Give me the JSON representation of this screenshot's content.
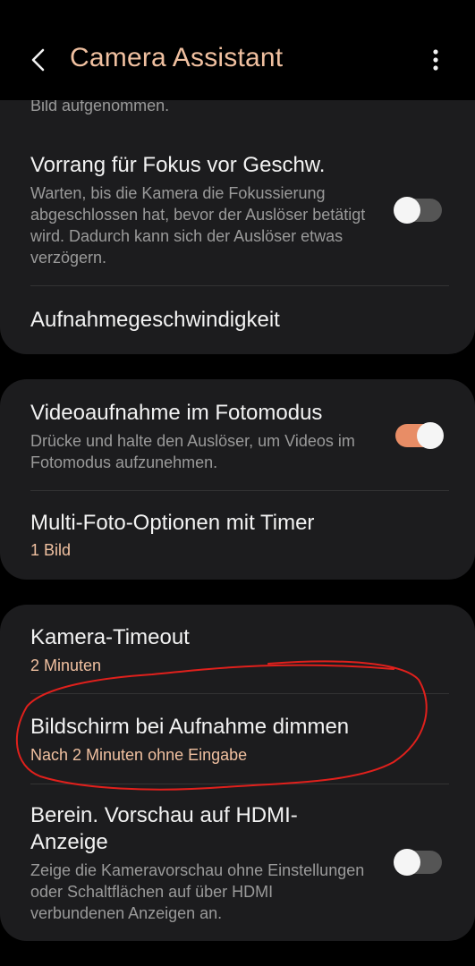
{
  "header": {
    "title": "Camera Assistant"
  },
  "cards": [
    {
      "partial_text": "Bild aufgenommen.",
      "rows": [
        {
          "title": "Vorrang für Fokus vor Geschw.",
          "description": "Warten, bis die Kamera die Fokussierung abgeschlossen hat, bevor der Auslöser betätigt wird. Dadurch kann sich der Auslöser etwas verzögern.",
          "toggle": false
        },
        {
          "title": "Aufnahmegeschwindigkeit"
        }
      ]
    },
    {
      "rows": [
        {
          "title": "Videoaufnahme im Fotomodus",
          "description": "Drücke und halte den Auslöser, um Videos im Fotomodus aufzunehmen.",
          "toggle": true
        },
        {
          "title": "Multi-Foto-Optionen mit Timer",
          "value": "1 Bild"
        }
      ]
    },
    {
      "rows": [
        {
          "title": "Kamera-Timeout",
          "value": "2 Minuten"
        },
        {
          "title": "Bildschirm bei Aufnahme dimmen",
          "value": "Nach 2 Minuten ohne Eingabe"
        },
        {
          "title": "Berein. Vorschau auf HDMI-Anzeige",
          "description": "Zeige die Kameravorschau ohne Einstellungen oder Schaltflächen auf über HDMI verbundenen Anzeigen an.",
          "toggle": false
        }
      ]
    }
  ],
  "colors": {
    "accent": "#f0c0a0",
    "toggle_on": "#e88d66",
    "card": "#1c1c1e",
    "annotation": "#e0201c"
  }
}
